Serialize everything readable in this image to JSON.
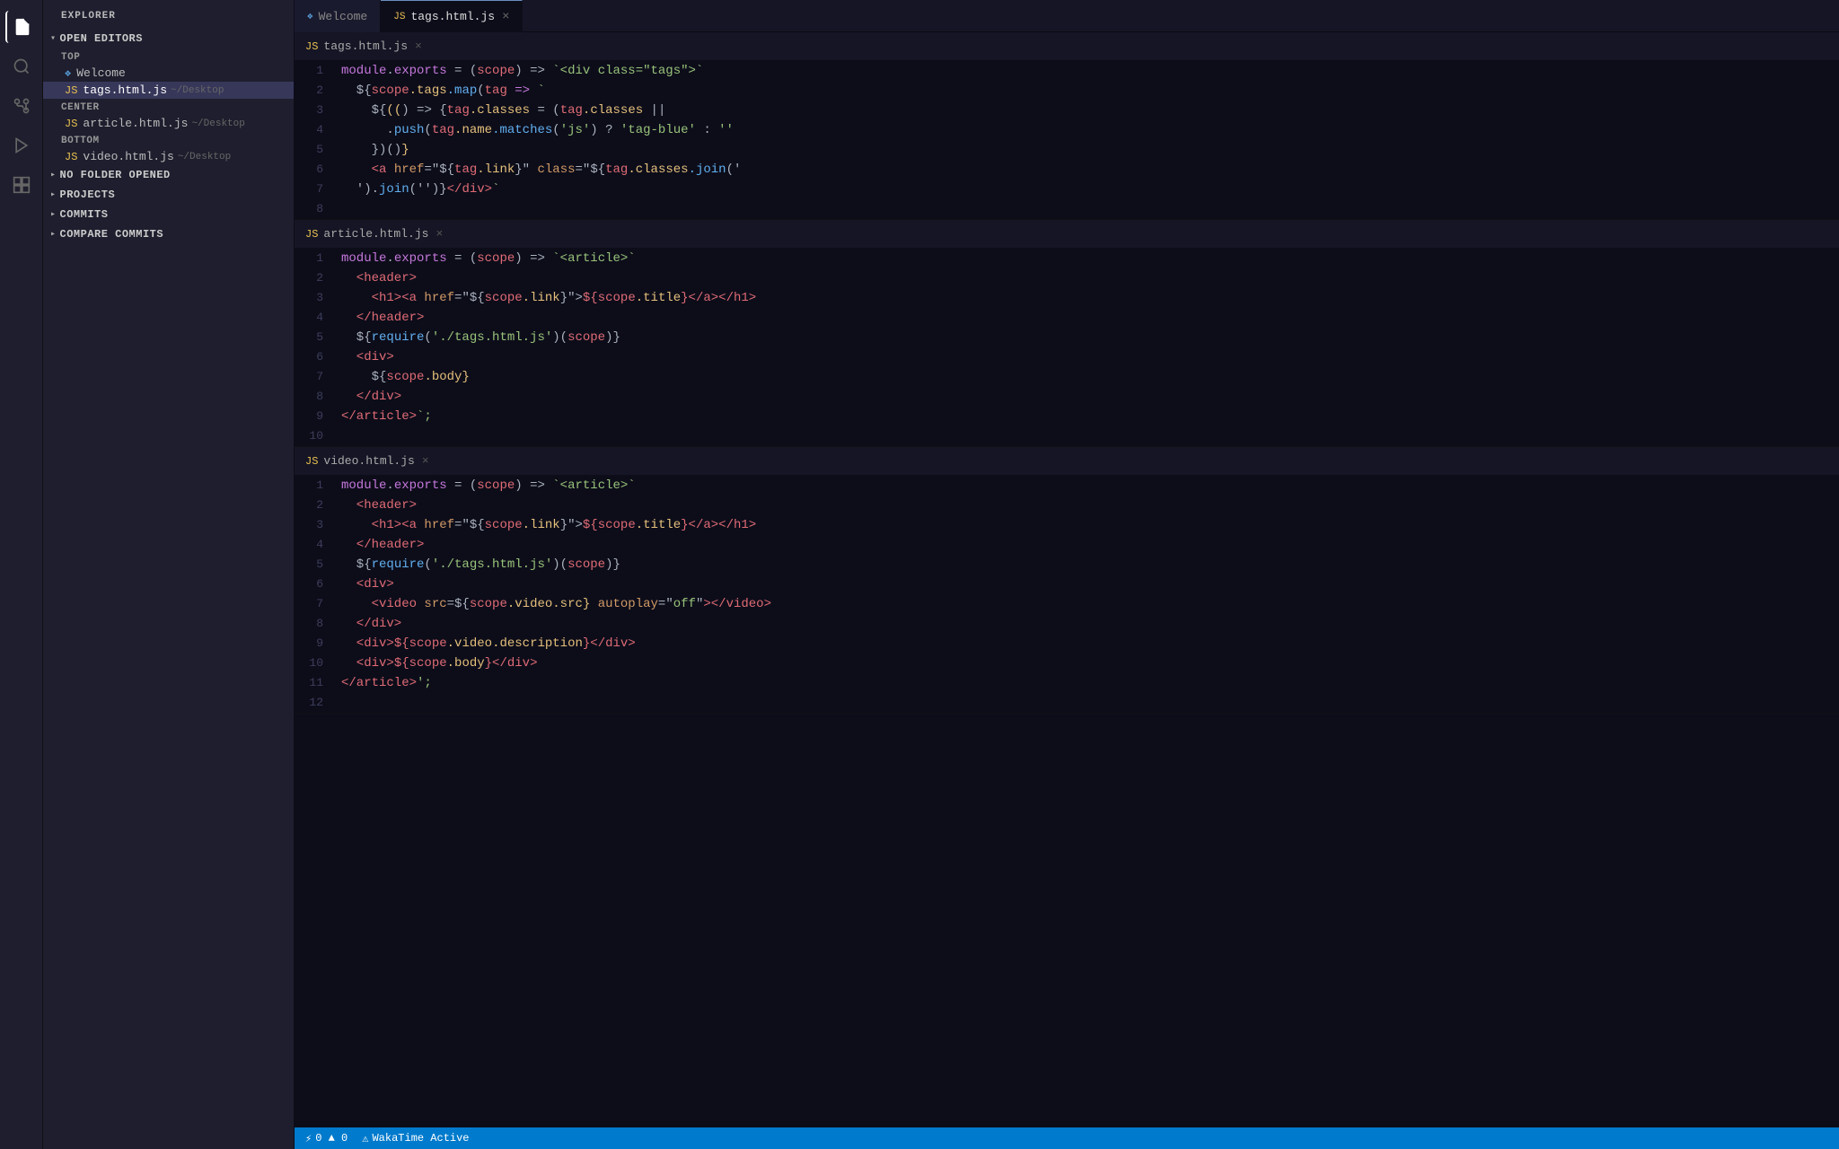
{
  "app": {
    "title": "EXPLORER"
  },
  "activity_bar": {
    "icons": [
      {
        "name": "files-icon",
        "glyph": "⎘",
        "active": true
      },
      {
        "name": "search-icon",
        "glyph": "🔍",
        "active": false
      },
      {
        "name": "git-icon",
        "glyph": "⌥",
        "active": false
      },
      {
        "name": "debug-icon",
        "glyph": "▶",
        "active": false
      },
      {
        "name": "extensions-icon",
        "glyph": "⊞",
        "active": false
      }
    ]
  },
  "sidebar": {
    "title": "EXPLORER",
    "sections": [
      {
        "name": "open-editors",
        "label": "OPEN EDITORS",
        "expanded": true,
        "subsections": [
          {
            "label": "TOP",
            "items": [
              {
                "name": "welcome-tab",
                "icon": "❖",
                "icon_type": "welcome",
                "filename": "Welcome",
                "path": ""
              },
              {
                "name": "tags-html-js-tab",
                "icon": "JS",
                "icon_type": "js",
                "filename": "tags.html.js",
                "path": "~/Desktop"
              }
            ]
          },
          {
            "label": "CENTER",
            "items": [
              {
                "name": "article-html-js-tab",
                "icon": "JS",
                "icon_type": "js",
                "filename": "article.html.js",
                "path": "~/Desktop"
              }
            ]
          },
          {
            "label": "BOTTOM",
            "items": [
              {
                "name": "video-html-js-tab",
                "icon": "JS",
                "icon_type": "js",
                "filename": "video.html.js",
                "path": "~/Desktop"
              }
            ]
          }
        ]
      },
      {
        "name": "no-folder-opened",
        "label": "NO FOLDER OPENED",
        "expanded": false,
        "items": []
      },
      {
        "name": "projects",
        "label": "PROJECTS",
        "expanded": false,
        "items": []
      },
      {
        "name": "commits",
        "label": "COMMITS",
        "expanded": false,
        "items": []
      },
      {
        "name": "compare-commits",
        "label": "COMPARE COMMITS",
        "expanded": false,
        "items": []
      }
    ]
  },
  "tabs": [
    {
      "name": "welcome-tab",
      "icon": "❖",
      "icon_type": "welcome",
      "label": "Welcome",
      "active": false,
      "closeable": false
    },
    {
      "name": "tags-html-js-tab",
      "icon": "JS",
      "icon_type": "js",
      "label": "tags.html.js",
      "active": true,
      "closeable": true
    }
  ],
  "editors": [
    {
      "name": "tags-editor",
      "filename": "tags.html.js",
      "lines": [
        {
          "num": 1,
          "tokens": [
            {
              "cls": "c-keyword",
              "t": "module"
            },
            {
              "cls": "c-punct",
              "t": "."
            },
            {
              "cls": "c-keyword",
              "t": "exports"
            },
            {
              "cls": "c-punct",
              "t": " = ("
            },
            {
              "cls": "c-param",
              "t": "scope"
            },
            {
              "cls": "c-punct",
              "t": ") => "
            },
            {
              "cls": "c-string",
              "t": "`<div class=\"tags\">`"
            }
          ]
        },
        {
          "num": 2,
          "tokens": [
            {
              "cls": "c-punct",
              "t": "  ${"
            },
            {
              "cls": "c-param",
              "t": "scope"
            },
            {
              "cls": "c-prop",
              "t": ".tags"
            },
            {
              "cls": "c-method",
              "t": ".map"
            },
            {
              "cls": "c-punct",
              "t": "("
            },
            {
              "cls": "c-param",
              "t": "tag"
            },
            {
              "cls": "c-arrow",
              "t": " => "
            },
            {
              "cls": "c-string",
              "t": "`"
            }
          ]
        },
        {
          "num": 3,
          "tokens": [
            {
              "cls": "c-punct",
              "t": "    ${"
            },
            {
              "cls": "c-bracket",
              "t": "(("
            },
            {
              "cls": "c-punct",
              "t": ") => {"
            },
            {
              "cls": "c-param",
              "t": "tag"
            },
            {
              "cls": "c-prop",
              "t": ".classes"
            },
            {
              "cls": "c-punct",
              "t": " = ("
            },
            {
              "cls": "c-param",
              "t": "tag"
            },
            {
              "cls": "c-prop",
              "t": ".classes"
            },
            {
              "cls": "c-punct",
              "t": " || "
            }
          ]
        },
        {
          "num": 4,
          "tokens": [
            {
              "cls": "c-punct",
              "t": "      ."
            },
            {
              "cls": "c-method",
              "t": "push"
            },
            {
              "cls": "c-punct",
              "t": "("
            },
            {
              "cls": "c-param",
              "t": "tag"
            },
            {
              "cls": "c-prop",
              "t": ".name"
            },
            {
              "cls": "c-method",
              "t": ".matches"
            },
            {
              "cls": "c-punct",
              "t": "("
            },
            {
              "cls": "c-string",
              "t": "'js'"
            },
            {
              "cls": "c-punct",
              "t": ") ? "
            },
            {
              "cls": "c-string",
              "t": "'tag-blue'"
            },
            {
              "cls": "c-punct",
              "t": " : "
            },
            {
              "cls": "c-string",
              "t": "''"
            }
          ]
        },
        {
          "num": 5,
          "tokens": [
            {
              "cls": "c-punct",
              "t": "    })()"
            },
            {
              "cls": "c-bracket",
              "t": "}"
            }
          ]
        },
        {
          "num": 6,
          "tokens": [
            {
              "cls": "c-punct",
              "t": "    "
            },
            {
              "cls": "c-tag",
              "t": "<a"
            },
            {
              "cls": "c-attr",
              "t": " href"
            },
            {
              "cls": "c-punct",
              "t": "=\"${"
            },
            {
              "cls": "c-param",
              "t": "tag"
            },
            {
              "cls": "c-prop",
              "t": ".link"
            },
            {
              "cls": "c-punct",
              "t": "}\" "
            },
            {
              "cls": "c-attr",
              "t": "class"
            },
            {
              "cls": "c-punct",
              "t": "=\"${"
            },
            {
              "cls": "c-param",
              "t": "tag"
            },
            {
              "cls": "c-prop",
              "t": ".classes"
            },
            {
              "cls": "c-method",
              "t": ".join"
            },
            {
              "cls": "c-punct",
              "t": "('"
            }
          ]
        },
        {
          "num": 7,
          "tokens": [
            {
              "cls": "c-punct",
              "t": "  ')."
            },
            {
              "cls": "c-method",
              "t": "join"
            },
            {
              "cls": "c-punct",
              "t": "('')}"
            },
            {
              "cls": "c-tag",
              "t": "</div>"
            },
            {
              "cls": "c-string",
              "t": "`"
            }
          ]
        },
        {
          "num": 8,
          "tokens": []
        }
      ]
    },
    {
      "name": "article-editor",
      "filename": "article.html.js",
      "lines": [
        {
          "num": 1,
          "tokens": [
            {
              "cls": "c-keyword",
              "t": "module"
            },
            {
              "cls": "c-punct",
              "t": "."
            },
            {
              "cls": "c-keyword",
              "t": "exports"
            },
            {
              "cls": "c-punct",
              "t": " = ("
            },
            {
              "cls": "c-param",
              "t": "scope"
            },
            {
              "cls": "c-punct",
              "t": ") => "
            },
            {
              "cls": "c-string",
              "t": "`<article>`"
            }
          ]
        },
        {
          "num": 2,
          "tokens": [
            {
              "cls": "c-tag",
              "t": "  <header>"
            }
          ]
        },
        {
          "num": 3,
          "tokens": [
            {
              "cls": "c-tag",
              "t": "    <h1>"
            },
            {
              "cls": "c-tag",
              "t": "<a"
            },
            {
              "cls": "c-attr",
              "t": " href"
            },
            {
              "cls": "c-punct",
              "t": "=\"${"
            },
            {
              "cls": "c-param",
              "t": "scope"
            },
            {
              "cls": "c-prop",
              "t": ".link"
            },
            {
              "cls": "c-punct",
              "t": "}\">"
            },
            {
              "cls": "c-param",
              "t": "${"
            },
            {
              "cls": "c-param",
              "t": "scope"
            },
            {
              "cls": "c-prop",
              "t": ".title"
            },
            {
              "cls": "c-tag",
              "t": "}</a></h1>"
            }
          ]
        },
        {
          "num": 4,
          "tokens": [
            {
              "cls": "c-tag",
              "t": "  </header>"
            }
          ]
        },
        {
          "num": 5,
          "tokens": [
            {
              "cls": "c-punct",
              "t": "  ${"
            },
            {
              "cls": "c-method",
              "t": "require"
            },
            {
              "cls": "c-punct",
              "t": "("
            },
            {
              "cls": "c-string",
              "t": "'./tags.html.js'"
            },
            {
              "cls": "c-punct",
              "t": ")("
            },
            {
              "cls": "c-param",
              "t": "scope"
            },
            {
              "cls": "c-punct",
              "t": ")}"
            }
          ]
        },
        {
          "num": 6,
          "tokens": [
            {
              "cls": "c-tag",
              "t": "  <div>"
            }
          ]
        },
        {
          "num": 7,
          "tokens": [
            {
              "cls": "c-punct",
              "t": "    ${"
            },
            {
              "cls": "c-param",
              "t": "scope"
            },
            {
              "cls": "c-prop",
              "t": ".body"
            },
            {
              "cls": "c-bracket",
              "t": "}"
            }
          ]
        },
        {
          "num": 8,
          "tokens": [
            {
              "cls": "c-tag",
              "t": "  </div>"
            }
          ]
        },
        {
          "num": 9,
          "tokens": [
            {
              "cls": "c-tag",
              "t": "</article>"
            },
            {
              "cls": "c-string",
              "t": "`;"
            }
          ]
        },
        {
          "num": 10,
          "tokens": []
        }
      ]
    },
    {
      "name": "video-editor",
      "filename": "video.html.js",
      "lines": [
        {
          "num": 1,
          "tokens": [
            {
              "cls": "c-keyword",
              "t": "module"
            },
            {
              "cls": "c-punct",
              "t": "."
            },
            {
              "cls": "c-keyword",
              "t": "exports"
            },
            {
              "cls": "c-punct",
              "t": " = ("
            },
            {
              "cls": "c-param",
              "t": "scope"
            },
            {
              "cls": "c-punct",
              "t": ") => "
            },
            {
              "cls": "c-string",
              "t": "`<article>`"
            }
          ]
        },
        {
          "num": 2,
          "tokens": [
            {
              "cls": "c-tag",
              "t": "  <header>"
            }
          ]
        },
        {
          "num": 3,
          "tokens": [
            {
              "cls": "c-tag",
              "t": "    <h1>"
            },
            {
              "cls": "c-tag",
              "t": "<a"
            },
            {
              "cls": "c-attr",
              "t": " href"
            },
            {
              "cls": "c-punct",
              "t": "=\"${"
            },
            {
              "cls": "c-param",
              "t": "scope"
            },
            {
              "cls": "c-prop",
              "t": ".link"
            },
            {
              "cls": "c-punct",
              "t": "}\">"
            },
            {
              "cls": "c-param",
              "t": "${"
            },
            {
              "cls": "c-param",
              "t": "scope"
            },
            {
              "cls": "c-prop",
              "t": ".title"
            },
            {
              "cls": "c-tag",
              "t": "}</a></h1>"
            }
          ]
        },
        {
          "num": 4,
          "tokens": [
            {
              "cls": "c-tag",
              "t": "  </header>"
            }
          ]
        },
        {
          "num": 5,
          "tokens": [
            {
              "cls": "c-punct",
              "t": "  ${"
            },
            {
              "cls": "c-method",
              "t": "require"
            },
            {
              "cls": "c-punct",
              "t": "("
            },
            {
              "cls": "c-string",
              "t": "'./tags.html.js'"
            },
            {
              "cls": "c-punct",
              "t": ")("
            },
            {
              "cls": "c-param",
              "t": "scope"
            },
            {
              "cls": "c-punct",
              "t": ")}"
            }
          ]
        },
        {
          "num": 6,
          "tokens": [
            {
              "cls": "c-tag",
              "t": "  <div>"
            }
          ]
        },
        {
          "num": 7,
          "tokens": [
            {
              "cls": "c-tag",
              "t": "    <video"
            },
            {
              "cls": "c-attr",
              "t": " src"
            },
            {
              "cls": "c-punct",
              "t": "=${"
            },
            {
              "cls": "c-param",
              "t": "scope"
            },
            {
              "cls": "c-prop",
              "t": ".video"
            },
            {
              "cls": "c-prop",
              "t": ".src"
            },
            {
              "cls": "c-bracket",
              "t": "}"
            },
            {
              "cls": "c-attr",
              "t": " autoplay"
            },
            {
              "cls": "c-punct",
              "t": "=\""
            },
            {
              "cls": "c-string",
              "t": "off"
            },
            {
              "cls": "c-punct",
              "t": "\""
            },
            {
              "cls": "c-tag",
              "t": "></video>"
            }
          ]
        },
        {
          "num": 8,
          "tokens": [
            {
              "cls": "c-tag",
              "t": "  </div>"
            }
          ]
        },
        {
          "num": 9,
          "tokens": [
            {
              "cls": "c-tag",
              "t": "  <div>"
            },
            {
              "cls": "c-param",
              "t": "${"
            },
            {
              "cls": "c-param",
              "t": "scope"
            },
            {
              "cls": "c-prop",
              "t": ".video"
            },
            {
              "cls": "c-prop",
              "t": ".description"
            },
            {
              "cls": "c-tag",
              "t": "}</div>"
            }
          ]
        },
        {
          "num": 10,
          "tokens": [
            {
              "cls": "c-tag",
              "t": "  <div>"
            },
            {
              "cls": "c-param",
              "t": "${"
            },
            {
              "cls": "c-param",
              "t": "scope"
            },
            {
              "cls": "c-prop",
              "t": ".body"
            },
            {
              "cls": "c-tag",
              "t": "}</div>"
            }
          ]
        },
        {
          "num": 11,
          "tokens": [
            {
              "cls": "c-tag",
              "t": "</article>"
            },
            {
              "cls": "c-string",
              "t": "';"
            }
          ]
        },
        {
          "num": 12,
          "tokens": []
        }
      ]
    }
  ],
  "status_bar": {
    "left": [
      {
        "icon": "⚡",
        "text": "0 ▲ 0"
      },
      {
        "icon": "⚠",
        "text": "WakaTime Active"
      }
    ]
  }
}
